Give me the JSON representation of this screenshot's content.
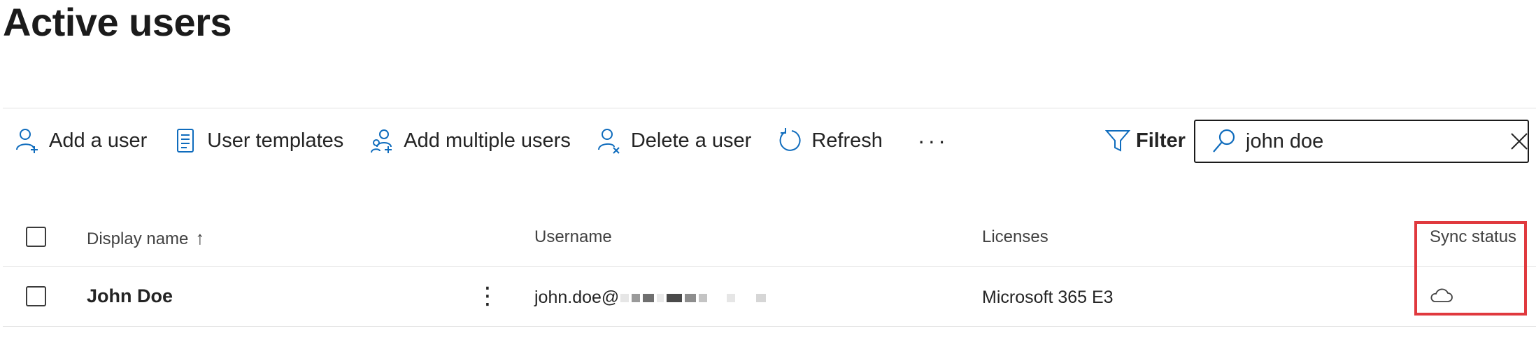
{
  "page": {
    "title": "Active users"
  },
  "toolbar": {
    "add_user": "Add a user",
    "user_templates": "User templates",
    "add_multiple": "Add multiple users",
    "delete_user": "Delete a user",
    "refresh": "Refresh",
    "more": "···",
    "filter": "Filter"
  },
  "search": {
    "value": "john doe",
    "placeholder": ""
  },
  "table": {
    "columns": {
      "display_name": "Display name",
      "sort_arrow": "↑",
      "username": "Username",
      "licenses": "Licenses",
      "sync_status": "Sync status"
    },
    "rows": [
      {
        "display_name": "John Doe",
        "username": "john.doe@",
        "licenses": "Microsoft 365 E3",
        "sync_status_icon": "cloud-icon"
      }
    ]
  },
  "icons": {
    "add_user": "add-user-icon",
    "templates": "templates-icon",
    "add_multiple": "add-multiple-users-icon",
    "delete_user": "delete-user-icon",
    "refresh": "refresh-icon",
    "filter": "filter-icon",
    "search": "search-icon",
    "clear": "clear-icon"
  },
  "colors": {
    "accent": "#0f6cbd",
    "highlight": "#e0393e",
    "text": "#242424"
  }
}
